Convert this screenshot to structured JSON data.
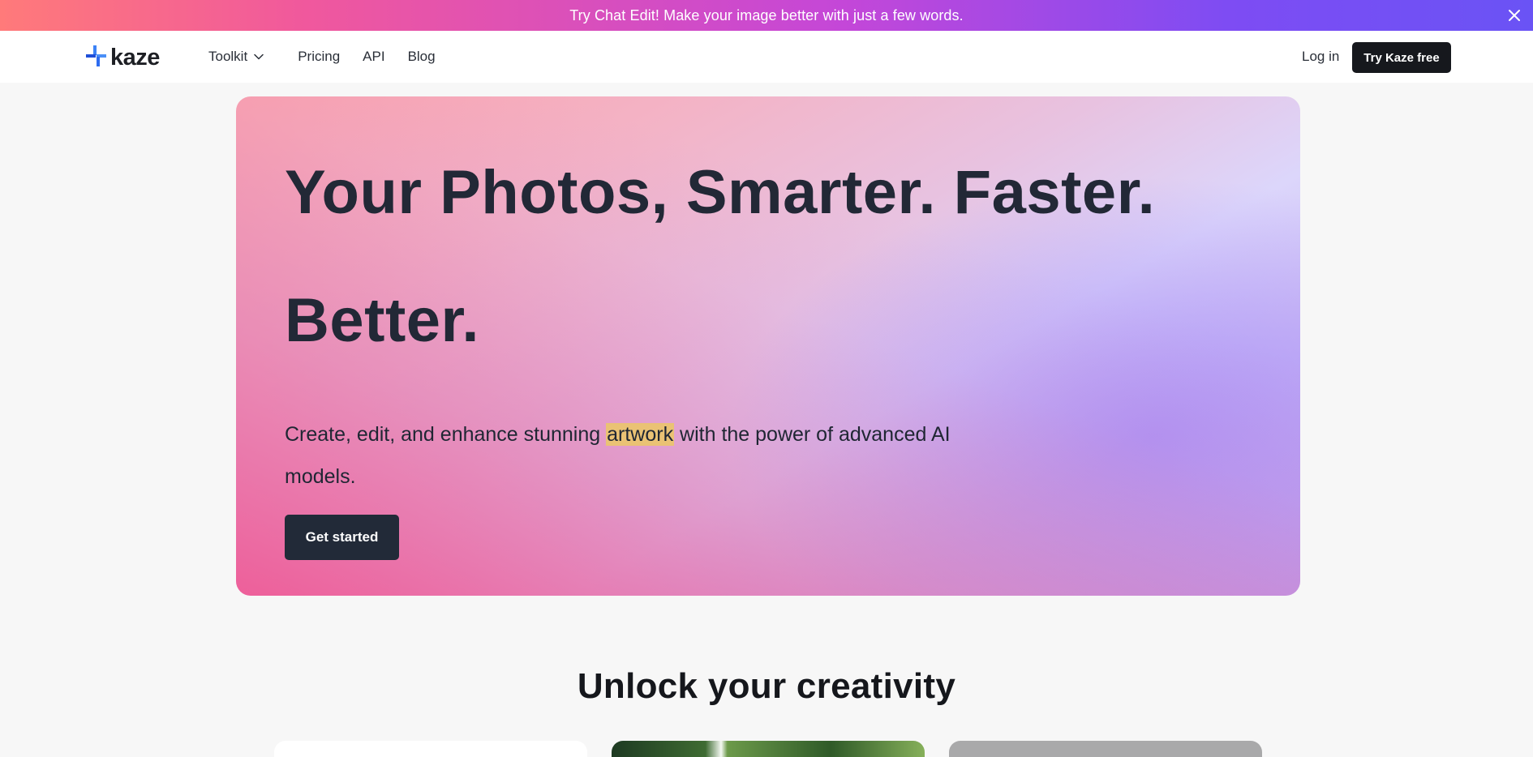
{
  "announcement": {
    "text": "Try Chat Edit!  Make your image better with just a few words.",
    "close_icon": "close-icon",
    "gradient_colors": [
      "#ff7a7a",
      "#f0589d",
      "#c447d8",
      "#7e4cf3",
      "#6a53f5"
    ]
  },
  "nav": {
    "logo_text": "kaze",
    "logo_icon": "kaze-plus-logo-icon",
    "items": [
      {
        "label": "Toolkit",
        "icon": "chevron-down-icon"
      },
      {
        "label": "Pricing"
      },
      {
        "label": "API"
      },
      {
        "label": "Blog"
      }
    ],
    "login_label": "Log in",
    "cta_label": "Try Kaze free"
  },
  "hero": {
    "title_line1": "Your Photos, Smarter. Faster.",
    "title_line2": "Better.",
    "subtitle_before": "Create, edit, and enhance stunning ",
    "subtitle_highlight": "artwork",
    "subtitle_after": " with the power of advanced AI models.",
    "cta_label": "Get started",
    "highlight_color": "#eac274"
  },
  "section": {
    "title": "Unlock your creativity"
  }
}
